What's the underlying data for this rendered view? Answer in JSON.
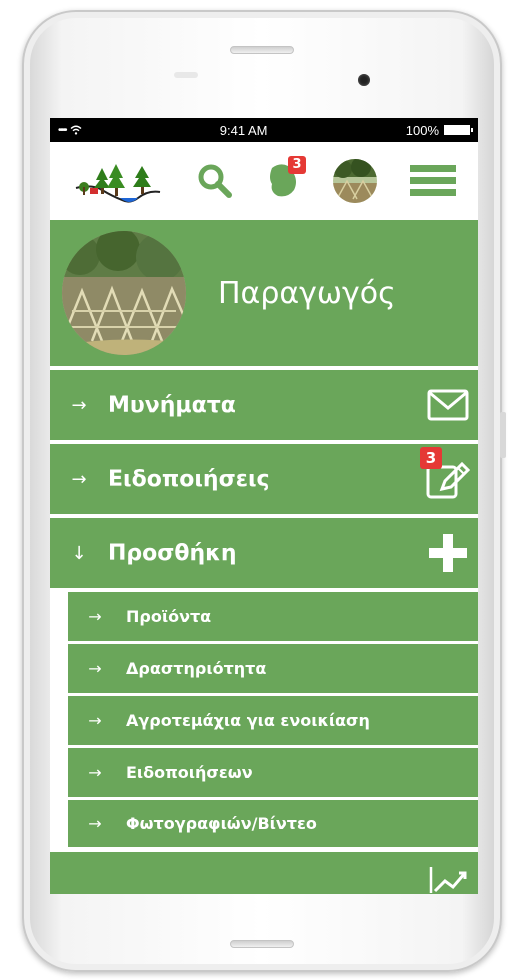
{
  "status_bar": {
    "signal": "•••••",
    "time": "9:41 AM",
    "battery_percent": "100%"
  },
  "top_bar": {
    "logo_icon": "farm-trees-logo",
    "search_icon": "search-icon",
    "map_badge": "3",
    "avatar_icon": "farm-avatar",
    "menu_icon": "hamburger-icon"
  },
  "profile": {
    "name": "Παραγωγός"
  },
  "menu": {
    "messages": {
      "arrow": "→",
      "label": "Μυνήματα",
      "icon": "envelope-icon"
    },
    "notifications": {
      "arrow": "→",
      "label": "Ειδοποιήσεις",
      "icon": "edit-note-icon",
      "badge": "3"
    },
    "add": {
      "arrow": "↓",
      "label": "Προσθήκη",
      "icon": "plus-icon"
    },
    "add_items": [
      {
        "arrow": "→",
        "label": "Προϊόντα"
      },
      {
        "arrow": "→",
        "label": "Δραστηριότητα"
      },
      {
        "arrow": "→",
        "label": "Αγροτεμάχια για ενοικίαση"
      },
      {
        "arrow": "→",
        "label": "Ειδοποιήσεων"
      },
      {
        "arrow": "→",
        "label": "Φωτογραφιών/Βίντεο"
      }
    ],
    "stats_icon": "trend-chart-icon"
  },
  "colors": {
    "menu_green": "#6aa65a",
    "badge_red": "#e53935"
  }
}
